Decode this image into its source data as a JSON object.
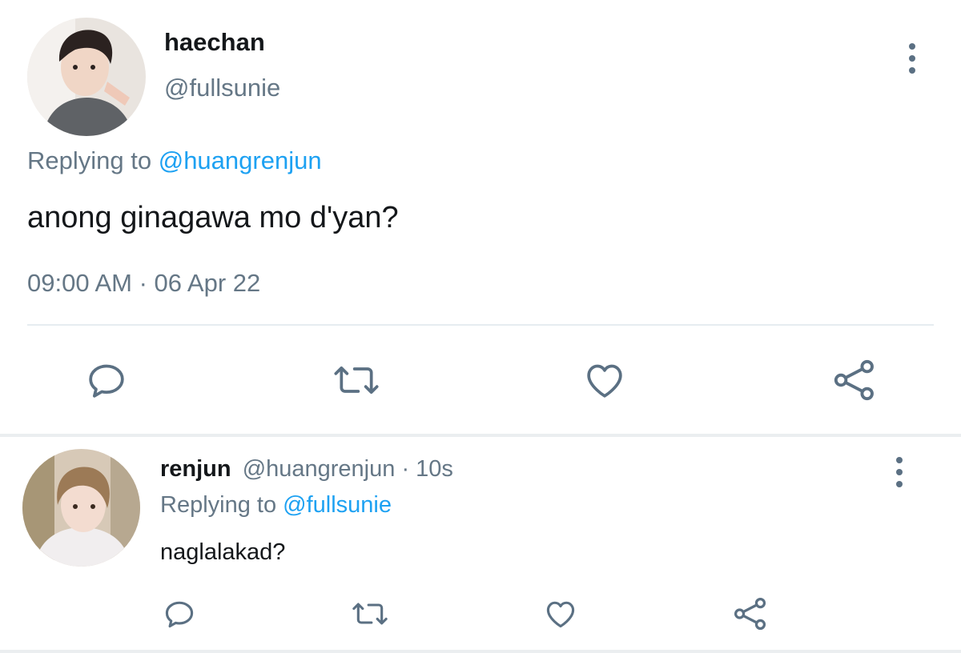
{
  "tweet": {
    "display_name": "haechan",
    "handle": "@fullsunie",
    "replying_prefix": "Replying to",
    "replying_handle": "@huangrenjun",
    "text": "anong ginagawa mo d'yan?",
    "timestamp": "09:00 AM · 06 Apr 22",
    "avatar": "avatar-photo",
    "actions": [
      "reply-icon",
      "retweet-icon",
      "like-icon",
      "share-icon"
    ]
  },
  "reply": {
    "display_name": "renjun",
    "handle": "@huangrenjun",
    "time": "· 10s",
    "replying_prefix": "Replying to",
    "replying_handle": "@fullsunie",
    "text": "naglalakad?",
    "avatar": "avatar-photo",
    "actions": [
      "reply-icon",
      "retweet-icon",
      "like-icon",
      "share-icon"
    ]
  },
  "colors": {
    "text": "#14171a",
    "muted": "#657786",
    "link": "#1da1f2",
    "icon": "#5b7083",
    "divider": "#e6ecf0"
  }
}
